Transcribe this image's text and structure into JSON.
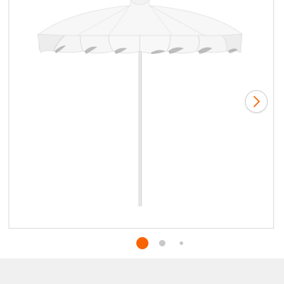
{
  "product_image": {
    "icon": "patio-umbrella-image"
  },
  "carousel": {
    "next_icon": "chevron-right-icon",
    "accent_color": "#f96302",
    "inactive_dot_color": "#c8c8c8",
    "small_dot_color": "#c8c8c8",
    "pages": [
      {
        "active": true
      },
      {
        "active": false
      },
      {
        "active": false
      }
    ]
  }
}
